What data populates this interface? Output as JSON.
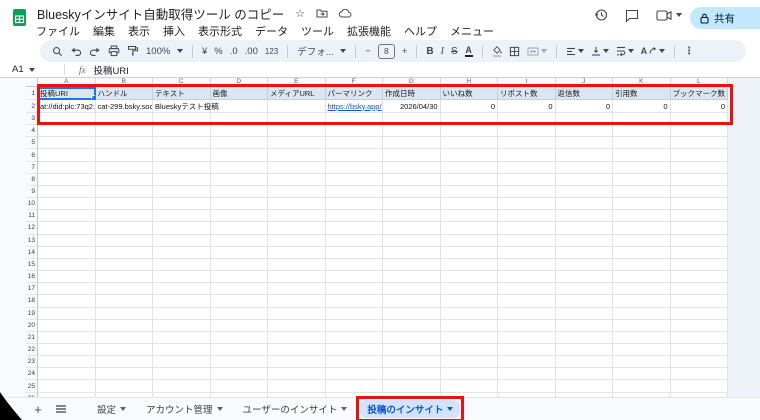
{
  "app": {
    "title": "Blueskyインサイト自動取得ツール のコピー",
    "menu_items": [
      "ファイル",
      "編集",
      "表示",
      "挿入",
      "表示形式",
      "データ",
      "ツール",
      "拡張機能",
      "ヘルプ",
      "メニュー"
    ],
    "icons": {
      "star": "☆",
      "more_vert": "⋮"
    }
  },
  "header_right": {
    "share_label": "共有"
  },
  "toolbar": {
    "zoom": "100%",
    "currency": "¥",
    "percent": "%",
    "decimal_decrease": ".0",
    "decimal_increase": ".00",
    "format_number": "123",
    "font_name": "デフォ...",
    "font_size": "8",
    "bold": "B",
    "italic": "I",
    "strikethrough": "S",
    "text_color": "A"
  },
  "formula_bar": {
    "cell_ref": "A1",
    "fx": "fx",
    "value": "投稿URI"
  },
  "grid": {
    "column_letters": [
      "A",
      "B",
      "C",
      "D",
      "E",
      "F",
      "G",
      "H",
      "I",
      "J",
      "K",
      "L"
    ],
    "row_count_visible": 26,
    "headers": [
      "投稿URI",
      "ハンドル",
      "テキスト",
      "画像",
      "メディアURL",
      "パーマリンク",
      "作成日時",
      "いいね数",
      "リポスト数",
      "返信数",
      "引用数",
      "ブックマーク数"
    ],
    "row2": [
      "at://did:plc:73q2:",
      "cat-299.bsky.soc",
      "Blueskyテスト投稿",
      "",
      "",
      "https://bsky.app/",
      "2026/04/30",
      "0",
      "0",
      "0",
      "0",
      "0"
    ],
    "selected_cell": "A1"
  },
  "sheet_bar": {
    "tabs": [
      {
        "label": "設定",
        "active": false
      },
      {
        "label": "アカウント管理",
        "active": false
      },
      {
        "label": "ユーザーのインサイト",
        "active": false
      },
      {
        "label": "投稿のインサイト",
        "active": true
      }
    ]
  },
  "colors": {
    "sheets_green": "#0f9d58",
    "selection_blue": "#1a73e8",
    "link_blue": "#1155cc",
    "header_fill": "#dce6f3",
    "active_tab_bg": "#d3e3fd",
    "active_tab_text": "#0b57d0",
    "annotation_red": "#ec1111",
    "toolbar_bg": "#edf2fa",
    "share_pill": "#c2e7ff"
  }
}
